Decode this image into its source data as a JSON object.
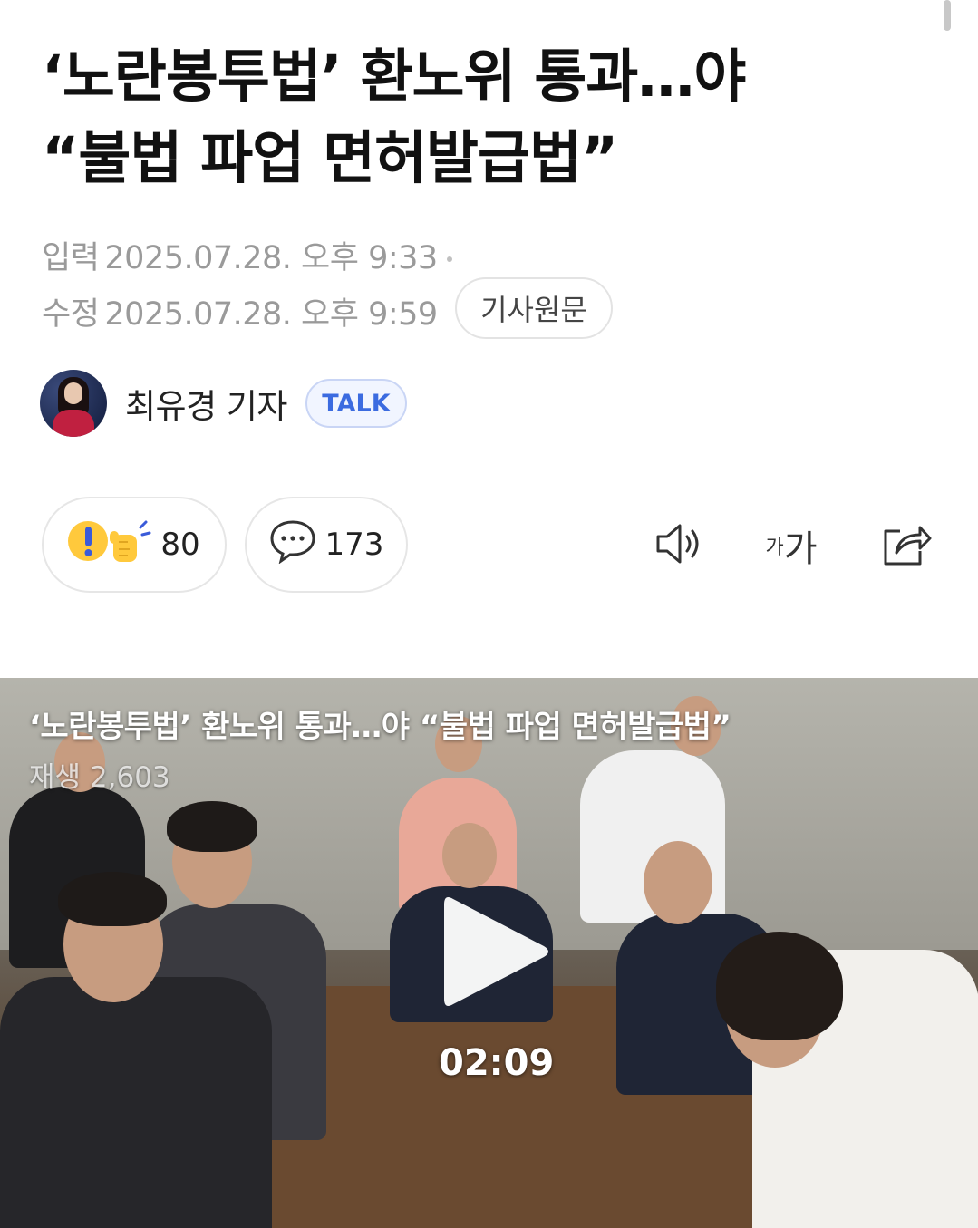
{
  "article": {
    "headline_line1": "‘노란봉투법’ 환노위 통과…야",
    "headline_line2": "“불법 파업 면허발급법”",
    "input_label": "입력",
    "input_time": "2025.07.28. 오후 9:33",
    "edit_label": "수정",
    "edit_time": "2025.07.28. 오후 9:59",
    "original_button": "기사원문"
  },
  "reporter": {
    "name": "최유경 기자",
    "talk_label": "TALK"
  },
  "actions": {
    "reaction_count": "80",
    "comment_count": "173",
    "font_size_small": "가",
    "font_size_large": "가"
  },
  "video": {
    "title": "‘노란봉투법’ 환노위 통과…야 “불법 파업 면허발급법”",
    "views": "재생 2,603",
    "duration": "02:09"
  },
  "colors": {
    "talk_accent": "#3b6be0",
    "meta_text": "#9a9a9a"
  },
  "icons": [
    "speaker-icon",
    "share-icon",
    "comment-bubble-icon",
    "reaction-emoji-icon",
    "play-icon"
  ]
}
